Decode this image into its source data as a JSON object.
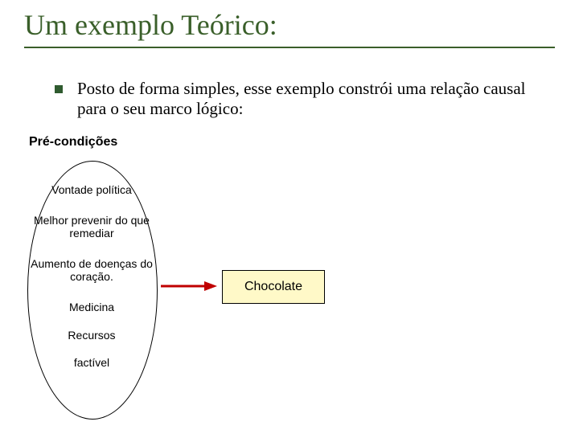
{
  "title": "Um exemplo Teórico:",
  "bullet": "Posto de forma simples, esse exemplo constrói uma relação causal para o seu marco lógico:",
  "preconditions_label": "Pré-condições",
  "preconditions": {
    "i0": "Vontade política",
    "i1": "Melhor prevenir do que remediar",
    "i2": "Aumento de doenças do coração.",
    "i3": "Medicina",
    "i4": "Recursos",
    "i5": "factível"
  },
  "box_label": "Chocolate",
  "colors": {
    "title_green": "#3a5f2a",
    "arrow_red": "#c00000",
    "box_fill": "#fff9c8"
  }
}
